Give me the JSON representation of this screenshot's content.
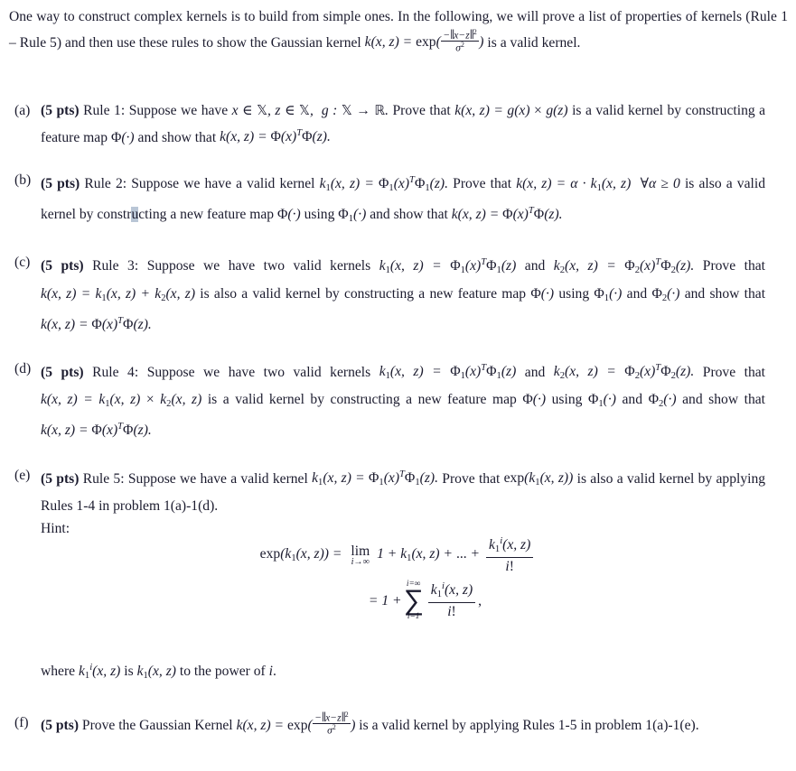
{
  "document": {
    "type": "problem-set",
    "background_color": "#ffffff",
    "text_color": "#1b1b2e",
    "selection_highlight_color": "#b9c6d6",
    "intro": {
      "sentence_1": "One way to construct complex kernels is to build from simple ones. In the following, we will prove a list of properties of kernels (Rule 1 – Rule 5) and then use these rules to show the Gaussian kernel",
      "formula_lead": "k(x, z) = exp(",
      "formula_numerator": "−‖x−z‖²",
      "formula_denominator": "σ²",
      "formula_tail": ") is a valid kernel."
    },
    "items": [
      {
        "marker": "(a)",
        "points": "(5 pts)",
        "rule_label": "Rule 1:",
        "text_1": "Suppose we have",
        "math_1": "x ∈ X, z ∈ X,",
        "math_2": "g : X → R.",
        "text_2": "Prove that",
        "math_3": "k(x, z) = g(x) × g(z)",
        "text_3": "is a valid kernel by constructing a feature map",
        "math_4": "Φ(·)",
        "text_4": "and show that",
        "math_5": "k(x, z) = Φ(x)ᵀΦ(z)."
      },
      {
        "marker": "(b)",
        "points": "(5 pts)",
        "rule_label": "Rule 2:",
        "text_1": "Suppose we have a valid kernel",
        "math_1": "k₁(x, z) = Φ₁(x)ᵀΦ₁(z).",
        "text_2": "Prove that",
        "math_2": "k(x, z) = α · k₁(x, z)",
        "math_3": "∀α ≥ 0",
        "text_3": "is also a valid kernel by constructing a new feature map",
        "selected_char": "u",
        "math_4": "Φ(·)",
        "text_4": "using",
        "math_5": "Φ₁(·)",
        "text_5": "and show that",
        "math_6": "k(x, z) = Φ(x)ᵀΦ(z)."
      },
      {
        "marker": "(c)",
        "points": "(5 pts)",
        "rule_label": "Rule 3:",
        "text_1": "Suppose we have two valid kernels",
        "math_1": "k₁(x, z) = Φ₁(x)ᵀΦ₁(z)",
        "text_2": "and",
        "math_2": "k₂(x, z) = Φ₂(x)ᵀΦ₂(z).",
        "text_3": "Prove that",
        "math_3": "k(x, z) = k₁(x, z) + k₂(x, z)",
        "text_4": "is also a valid kernel by constructing a new feature map",
        "math_4": "Φ(·)",
        "text_5": "using",
        "math_5": "Φ₁(·)",
        "text_6": "and",
        "math_6": "Φ₂(·)",
        "text_7": "and show that",
        "math_7": "k(x, z) = Φ(x)ᵀΦ(z)."
      },
      {
        "marker": "(d)",
        "points": "(5 pts)",
        "rule_label": "Rule 4:",
        "text_1": "Suppose we have two valid kernels",
        "math_1": "k₁(x, z) = Φ₁(x)ᵀΦ₁(z)",
        "text_2": "and",
        "math_2": "k₂(x, z) = Φ₂(x)ᵀΦ₂(z).",
        "text_3": "Prove that",
        "math_3": "k(x, z) = k₁(x, z) × k₂(x, z)",
        "text_4": "is a valid kernel by constructing a new feature map",
        "math_4": "Φ(·)",
        "text_5": "using",
        "math_5": "Φ₁(·)",
        "text_6": "and",
        "math_6": "Φ₂(·)",
        "text_7": "and show that",
        "math_7": "k(x, z) = Φ(x)ᵀΦ(z)."
      },
      {
        "marker": "(e)",
        "points": "(5 pts)",
        "rule_label": "Rule 5:",
        "text_1": "Suppose we have a valid kernel",
        "math_1": "k₁(x, z) = Φ₁(x)ᵀΦ₁(z).",
        "text_2": "Prove that",
        "math_2": "exp(k₁(x, z))",
        "text_3": "is also a valid kernel by applying Rules 1-4 in problem 1(a)-1(d).",
        "hint_label": "Hint:"
      },
      {
        "marker": "(f)",
        "points": "(5 pts)",
        "text_1": "Prove the Gaussian Kernel",
        "math_1": "k(x, z) = exp(",
        "formula_numerator": "−‖x−z‖²",
        "formula_denominator": "σ²",
        "math_2": ")",
        "text_2": "is a valid kernel by applying Rules 1-5 in problem 1(a)-1(e)."
      }
    ],
    "equation": {
      "line1_lhs": "exp(k₁(x, z)) =",
      "line1_limit_top": "lim",
      "line1_limit_bottom": "i→∞",
      "line1_body": "1 + k₁(x, z) + ... +",
      "line1_frac_num": "k₁ⁱ(x, z)",
      "line1_frac_den": "i!",
      "line2_lhs": "= 1 +",
      "line2_sum_top": "i=∞",
      "line2_sum_glyph": "∑",
      "line2_sum_bottom": "i=1",
      "line2_frac_num": "k₁ⁱ(x, z)",
      "line2_frac_den": "i!",
      "line2_trailing": ","
    },
    "where_line": {
      "text_1": "where",
      "math_1": "k₁ⁱ(x, z)",
      "text_2": "is",
      "math_2": "k₁(x, z)",
      "text_3": "to the power of",
      "math_3": "i",
      "text_4": "."
    }
  }
}
